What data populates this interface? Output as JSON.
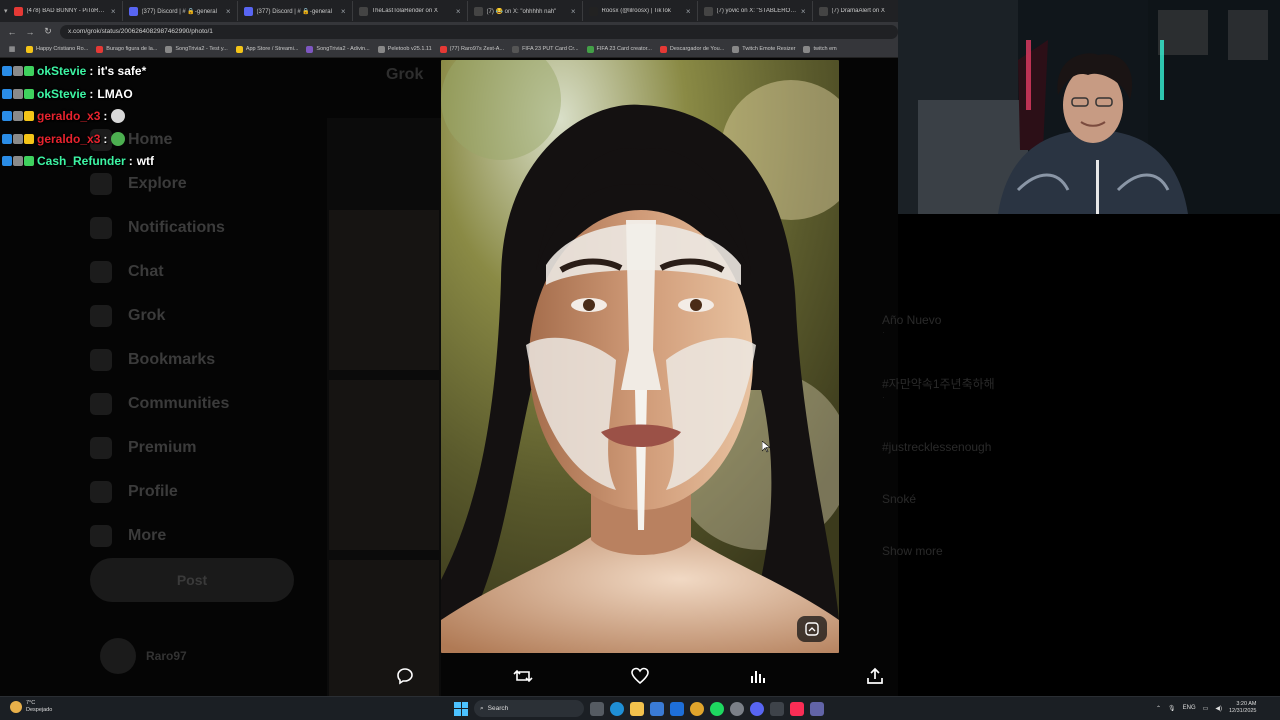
{
  "browser": {
    "tabs": [
      {
        "label": "(478) BAD BUNNY - PiToRRO",
        "color": "#e53935"
      },
      {
        "label": "(377) Discord | # 🔒-general",
        "color": "#5865f2"
      },
      {
        "label": "(377) Discord | # 🔒-general",
        "color": "#5865f2"
      },
      {
        "label": "TheLastTolaRender on X",
        "color": "#444444"
      },
      {
        "label": "(7) 😂 on X: \"ohhhhh nah\"",
        "color": "#444444"
      },
      {
        "label": "Roosx (@lilroosx) | TikTok",
        "color": "#222222"
      },
      {
        "label": "(7) yovic on X: \"STABLERONA\"",
        "color": "#444444"
      },
      {
        "label": "(7) DramaAlert on X",
        "color": "#444444"
      }
    ],
    "url": "x.com/grok/status/2006264082987462990/photo/1",
    "bookmarks": [
      {
        "label": "Happy Cristiano Ro...",
        "color": "#f5c518"
      },
      {
        "label": "Burago figura de la...",
        "color": "#e53935"
      },
      {
        "label": "SongTrivia2 - Test y...",
        "color": "#888888"
      },
      {
        "label": "App Store / Streami...",
        "color": "#f5c518"
      },
      {
        "label": "SongTrivia2 - Adivin...",
        "color": "#7e57c2"
      },
      {
        "label": "Peletoob v25.1.11",
        "color": "#888888"
      },
      {
        "label": "(77) Raro97s Zest-A...",
        "color": "#e53935"
      },
      {
        "label": "FIFA 23 PUT Card Cr...",
        "color": "#555555"
      },
      {
        "label": "FIFA 23 Card creator...",
        "color": "#43a047"
      },
      {
        "label": "Descargador de You...",
        "color": "#e53935"
      },
      {
        "label": "Twitch Emote Resizer",
        "color": "#888888"
      },
      {
        "label": "twitch em",
        "color": "#888888"
      }
    ]
  },
  "xpage": {
    "header": "Grok",
    "nav": [
      "Home",
      "Explore",
      "Notifications",
      "Chat",
      "Grok",
      "Bookmarks",
      "Communities",
      "Premium",
      "Profile",
      "More"
    ],
    "post_button": "Post",
    "user": "Raro97",
    "trends": [
      {
        "title": "Año Nuevo",
        "small": "·"
      },
      {
        "title": "#자만약속1주년축하해",
        "small": "·"
      },
      {
        "title": "#justrecklessenough",
        "small": ""
      },
      {
        "title": "Snoké",
        "small": ""
      },
      {
        "title": "Show more",
        "small": ""
      }
    ]
  },
  "chat": [
    {
      "user": "okStevie",
      "user_color": "#3df5a4",
      "text": "it's safe*",
      "badges": [
        "#2a8ce6",
        "#8a8a8a",
        "#3fd15e"
      ]
    },
    {
      "user": "okStevie",
      "user_color": "#3df5a4",
      "text": "LMAO",
      "badges": [
        "#2a8ce6",
        "#8a8a8a",
        "#3fd15e"
      ]
    },
    {
      "user": "geraldo_x3",
      "user_color": "#e8232e",
      "text": "",
      "emote": "#d8d8d8",
      "badges": [
        "#2a8ce6",
        "#8a8a8a",
        "#f5c518"
      ]
    },
    {
      "user": "geraldo_x3",
      "user_color": "#e8232e",
      "text": "",
      "emote": "#4caf50",
      "badges": [
        "#2a8ce6",
        "#8a8a8a",
        "#f5c518"
      ]
    },
    {
      "user": "Cash_Refunder",
      "user_color": "#3df5a4",
      "text": "wtf",
      "badges": [
        "#2a8ce6",
        "#8a8a8a",
        "#3fd15e"
      ]
    }
  ],
  "taskbar": {
    "weather_temp": "7°C",
    "weather_desc": "Despejado",
    "search_label": "Search",
    "lang": "ENG",
    "time": "3:20 AM",
    "date": "12/31/2025"
  },
  "colors": {
    "accent": "#1d9bf0",
    "chat_green": "#3df5a4",
    "chat_red": "#e8232e"
  }
}
